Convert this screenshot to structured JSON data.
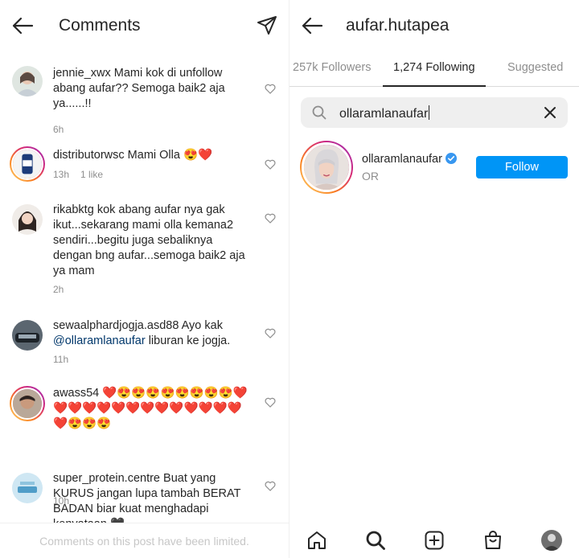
{
  "comments_screen": {
    "title": "Comments",
    "limit_notice": "Comments on this post have been limited.",
    "comments": [
      {
        "username": "jennie_xwx",
        "text": "Mami kok di unfollow abang aufar?? Semoga baik2 aja ya......!!",
        "time": "6h",
        "likes": ""
      },
      {
        "username": "distributorwsc",
        "text": "Mami Olla 😍❤️",
        "time": "13h",
        "likes": "1 like"
      },
      {
        "username": "rikabktg",
        "text": "kok abang aufar nya gak ikut...sekarang mami olla kemana2 sendiri...begitu juga sebaliknya dengan bng aufar...semoga baik2 aja ya mam",
        "time": "2h",
        "likes": ""
      },
      {
        "username": "sewaalphardjogja.asd88",
        "text_before": "Ayo kak ",
        "mention": "@ollaramlanaufar",
        "text_after": " liburan ke jogja.",
        "time": "11h",
        "likes": ""
      },
      {
        "username": "awass54",
        "text": "❤️😍😍😍😍😍😍😍😍❤️❤️❤️❤️❤️❤️❤️❤️❤️❤️❤️❤️❤️❤️❤️😍😍😍",
        "time": "10h",
        "likes": ""
      },
      {
        "username": "super_protein.centre",
        "text": "Buat yang KURUS jangan lupa tambah BERAT BADAN biar kuat menghadapi kenyataan 🖤",
        "time": "",
        "likes": ""
      }
    ]
  },
  "following_screen": {
    "title": "aufar.hutapea",
    "tabs": [
      "257k Followers",
      "1,274 Following",
      "Suggested"
    ],
    "active_tab": 1,
    "search_value": "ollaramlanaufar",
    "result": {
      "username": "ollaramlanaufar",
      "subtitle": "OR",
      "verified": true,
      "follow_label": "Follow"
    },
    "nav_icons": [
      "home-icon",
      "search-icon",
      "new-post-icon",
      "shop-icon",
      "profile-avatar"
    ]
  },
  "colors": {
    "primary_text": "#262626",
    "secondary_text": "#8e8e8e",
    "follow_button": "#0095f6",
    "mention": "#00376b"
  }
}
